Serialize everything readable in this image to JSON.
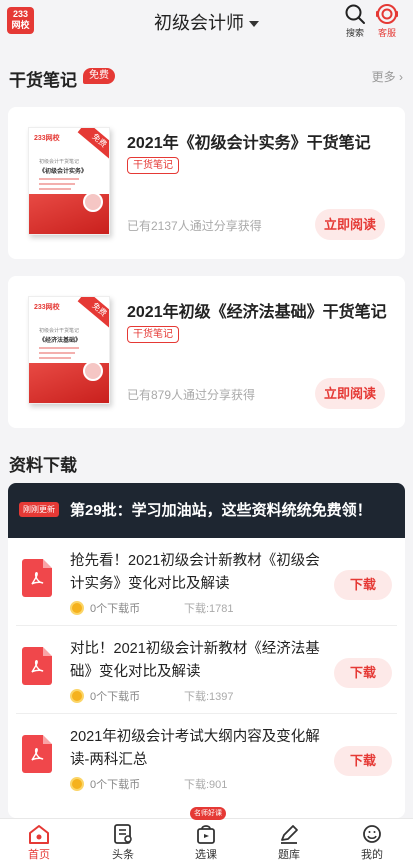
{
  "header": {
    "logo_line1": "233",
    "logo_line2": "网校",
    "title": "初级会计师",
    "search_label": "搜索",
    "service_label": "客服"
  },
  "notes_section": {
    "title": "干货笔记",
    "badge": "免费",
    "more": "更多",
    "cards": [
      {
        "title": "2021年《初级会计实务》干货笔记",
        "tag": "干货笔记",
        "shared": "已有2137人通过分享获得",
        "button": "立即阅读",
        "book_logo": "233网校",
        "book_ribbon": "免费",
        "book_subtitle": "初级会计干货笔记",
        "book_name": "《初级会计实务》"
      },
      {
        "title": "2021年初级《经济法基础》干货笔记",
        "tag": "干货笔记",
        "shared": "已有879人通过分享获得",
        "button": "立即阅读",
        "book_logo": "233网校",
        "book_ribbon": "免费",
        "book_subtitle": "初级会计干货笔记",
        "book_name": "《经济法基础》"
      }
    ]
  },
  "downloads_section": {
    "title": "资料下载",
    "banner_badge": "刚刚更新",
    "banner_text": "第29批：学习加油站，这些资料统统免费领！",
    "items": [
      {
        "title": "抢先看！2021初级会计新教材《初级会计实务》变化对比及解读",
        "cost": "0个下载币",
        "count": "下载:1781",
        "button": "下载"
      },
      {
        "title": "对比！2021初级会计新教材《经济法基础》变化对比及解读",
        "cost": "0个下载币",
        "count": "下载:1397",
        "button": "下载"
      },
      {
        "title": "2021年初级会计考试大纲内容及变化解读-两科汇总",
        "cost": "0个下载币",
        "count": "下载:901",
        "button": "下载"
      }
    ]
  },
  "bottom_nav": {
    "badge": "名师好课",
    "items": [
      {
        "label": "首页",
        "icon": "home-icon",
        "active": true
      },
      {
        "label": "头条",
        "icon": "news-icon",
        "active": false
      },
      {
        "label": "选课",
        "icon": "course-bag-icon",
        "active": false
      },
      {
        "label": "题库",
        "icon": "pen-icon",
        "active": false
      },
      {
        "label": "我的",
        "icon": "profile-icon",
        "active": false
      }
    ]
  },
  "colors": {
    "accent": "#e53935",
    "accent_light": "#fde9e8",
    "banner_dark": "#1e2631",
    "background": "#f4f4f6"
  }
}
